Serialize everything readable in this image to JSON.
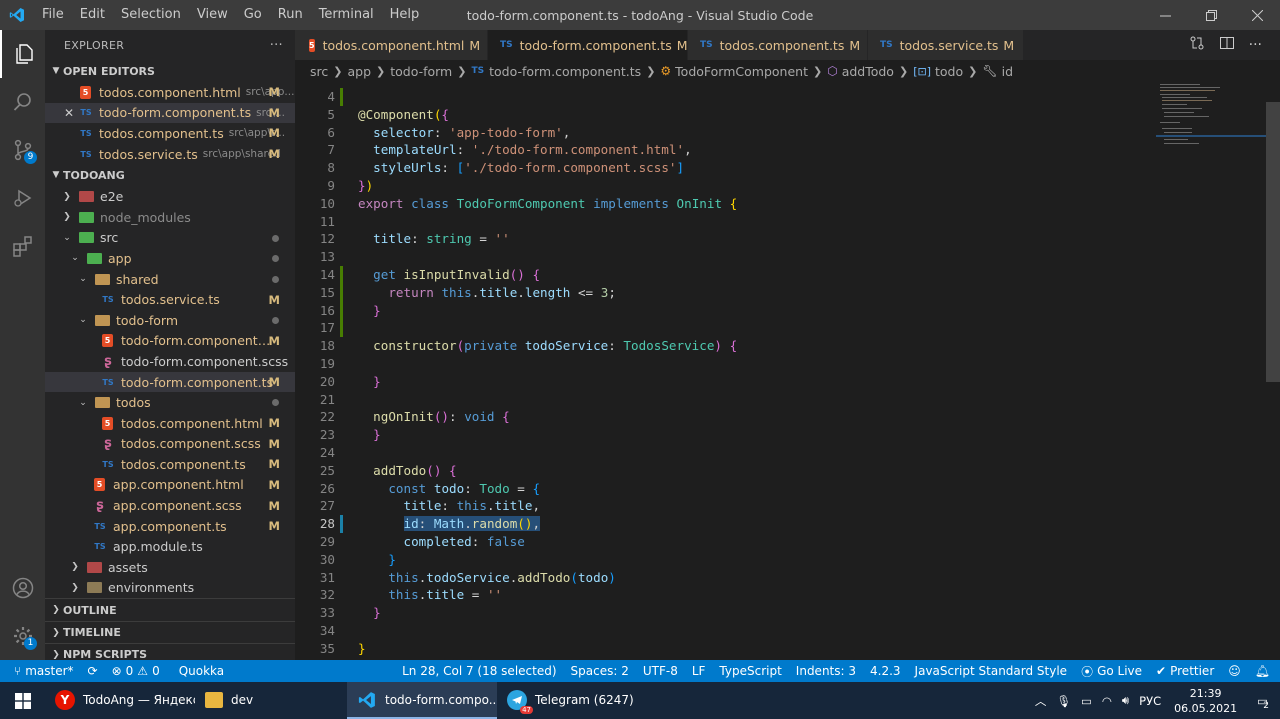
{
  "window": {
    "title": "todo-form.component.ts - todoAng - Visual Studio Code",
    "menu": [
      "File",
      "Edit",
      "Selection",
      "View",
      "Go",
      "Run",
      "Terminal",
      "Help"
    ]
  },
  "activity_bar": {
    "source_control_badge": "9",
    "settings_badge": "1"
  },
  "sidebar": {
    "header": "EXPLORER",
    "more": "···",
    "open_editors_title": "OPEN EDITORS",
    "open_editors": [
      {
        "name": "todos.component.html",
        "path": "src\\app...",
        "status": "M",
        "icon": "5"
      },
      {
        "name": "todo-form.component.ts",
        "path": "src\\...",
        "status": "M",
        "icon": "TS"
      },
      {
        "name": "todos.component.ts",
        "path": "src\\app\\t...",
        "status": "M",
        "icon": "TS"
      },
      {
        "name": "todos.service.ts",
        "path": "src\\app\\shared",
        "status": "M",
        "icon": "TS"
      }
    ],
    "project_title": "TODOANG",
    "tree": [
      {
        "name": "e2e"
      },
      {
        "name": "node_modules"
      },
      {
        "name": "src"
      },
      {
        "name": "app"
      },
      {
        "name": "shared"
      },
      {
        "name": "todos.service.ts",
        "status": "M",
        "icon": "TS"
      },
      {
        "name": "todo-form"
      },
      {
        "name": "todo-form.component.html",
        "status": "M",
        "icon": "5"
      },
      {
        "name": "todo-form.component.scss"
      },
      {
        "name": "todo-form.component.ts",
        "status": "M",
        "icon": "TS"
      },
      {
        "name": "todos"
      },
      {
        "name": "todos.component.html",
        "status": "M",
        "icon": "5"
      },
      {
        "name": "todos.component.scss",
        "status": "M"
      },
      {
        "name": "todos.component.ts",
        "status": "M",
        "icon": "TS"
      },
      {
        "name": "app.component.html",
        "status": "M",
        "icon": "5"
      },
      {
        "name": "app.component.scss",
        "status": "M"
      },
      {
        "name": "app.component.ts",
        "status": "M",
        "icon": "TS"
      },
      {
        "name": "app.module.ts",
        "icon": "TS"
      },
      {
        "name": "assets"
      },
      {
        "name": "environments"
      }
    ],
    "outline_title": "OUTLINE",
    "timeline_title": "TIMELINE",
    "npm_scripts_title": "NPM SCRIPTS"
  },
  "tabs": [
    {
      "name": "todos.component.html",
      "status": "M",
      "icon": "5"
    },
    {
      "name": "todo-form.component.ts",
      "status": "M",
      "icon": "TS",
      "close": "✕"
    },
    {
      "name": "todos.component.ts",
      "status": "M",
      "icon": "TS"
    },
    {
      "name": "todos.service.ts",
      "status": "M",
      "icon": "TS"
    }
  ],
  "breadcrumb": [
    "src",
    "app",
    "todo-form",
    "todo-form.component.ts",
    "TodoFormComponent",
    "addTodo",
    "todo",
    "id"
  ],
  "breadcrumb_icons": {
    "ts": "TS"
  },
  "editor": {
    "line_numbers": [
      "4",
      "5",
      "6",
      "7",
      "8",
      "9",
      "10",
      "11",
      "12",
      "13",
      "14",
      "15",
      "16",
      "17",
      "18",
      "19",
      "20",
      "21",
      "22",
      "23",
      "24",
      "25",
      "26",
      "27",
      "28",
      "29",
      "30",
      "31",
      "32",
      "33",
      "34",
      "35"
    ],
    "current_line": "28"
  },
  "statusbar": {
    "branch": "master*",
    "errors": "0",
    "warnings": "0",
    "quokka": "Quokka",
    "position": "Ln 28, Col 7 (18 selected)",
    "spaces": "Spaces: 2",
    "encoding": "UTF-8",
    "eol": "LF",
    "language": "TypeScript",
    "indents": "Indents: 3",
    "version": "4.2.3",
    "style": "JavaScript Standard Style",
    "golive": "Go Live",
    "prettier": "Prettier"
  },
  "taskbar": {
    "tasks": [
      {
        "label": "TodoAng — Яндекс..."
      },
      {
        "label": "dev"
      },
      {
        "label": "todo-form.compo..."
      },
      {
        "label": "Telegram (6247)",
        "badge": "47"
      }
    ],
    "lang": "РУС",
    "time": "21:39",
    "date": "06.05.2021",
    "notif": "2"
  }
}
